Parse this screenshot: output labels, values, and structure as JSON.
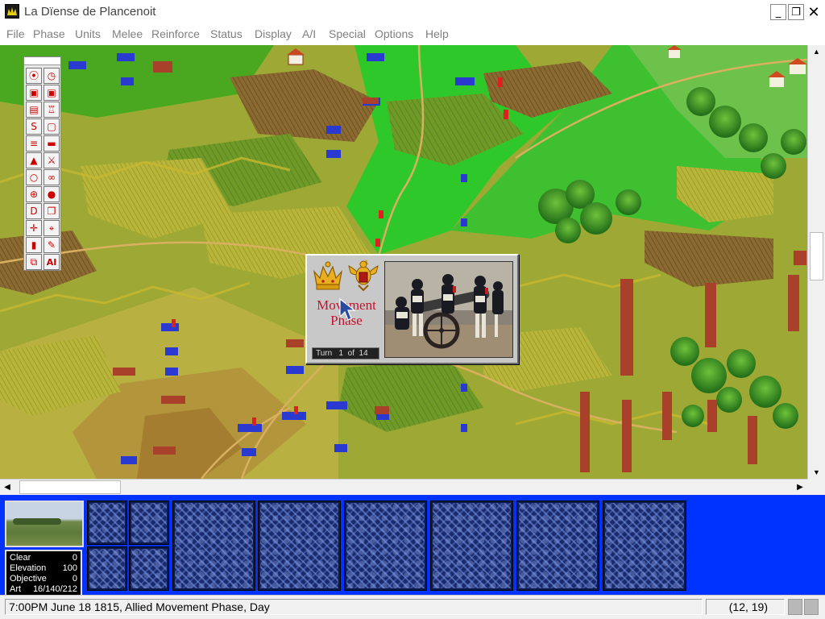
{
  "window": {
    "title": "La Dïense de Plancenoit",
    "minimize_glyph": "_",
    "maximize_glyph": "❐",
    "close_glyph": "✕"
  },
  "menu": [
    {
      "label": "File"
    },
    {
      "label": "Phase"
    },
    {
      "label": "Units"
    },
    {
      "label": "Melee"
    },
    {
      "label": "Reinforce"
    },
    {
      "label": "Status"
    },
    {
      "label": "Display"
    },
    {
      "label": "A/I"
    },
    {
      "label": "Special"
    },
    {
      "label": "Options"
    },
    {
      "label": "Help"
    }
  ],
  "toolbar": {
    "buttons": [
      {
        "icon": "compass-icon",
        "glyph": "⦿"
      },
      {
        "icon": "clock-icon",
        "glyph": "◷"
      },
      {
        "icon": "trash-can-icon",
        "glyph": "▣"
      },
      {
        "icon": "trash-all-icon",
        "glyph": "▣"
      },
      {
        "icon": "stack-icon",
        "glyph": "▤"
      },
      {
        "icon": "troops-icon",
        "glyph": "♖"
      },
      {
        "icon": "scroll-s-icon",
        "glyph": "S"
      },
      {
        "icon": "frame-icon",
        "glyph": "▢"
      },
      {
        "icon": "report-icon",
        "glyph": "≡"
      },
      {
        "icon": "oval-icon",
        "glyph": "▬"
      },
      {
        "icon": "pyramid-icon",
        "glyph": "▲"
      },
      {
        "icon": "crossed-swords-icon",
        "glyph": "⚔"
      },
      {
        "icon": "circle-icon",
        "glyph": "○"
      },
      {
        "icon": "binoculars-icon",
        "glyph": "∞"
      },
      {
        "icon": "target-icon",
        "glyph": "⊕"
      },
      {
        "icon": "ball-icon",
        "glyph": "●"
      },
      {
        "icon": "d-icon",
        "glyph": "D"
      },
      {
        "icon": "windows-icon",
        "glyph": "❐"
      },
      {
        "icon": "move-arrows-icon",
        "glyph": "✛"
      },
      {
        "icon": "crosshair-icon",
        "glyph": "⌖"
      },
      {
        "icon": "door-icon",
        "glyph": "▮"
      },
      {
        "icon": "pen-icon",
        "glyph": "✎"
      },
      {
        "icon": "overlap-icon",
        "glyph": "⧉"
      },
      {
        "icon": "ai-icon",
        "glyph": "AI"
      }
    ]
  },
  "dialog": {
    "title": "Movement Phase",
    "turn": "Turn   1  of  14"
  },
  "terrain": {
    "rows": [
      {
        "label": "Clear",
        "value": "0"
      },
      {
        "label": "Elevation",
        "value": "100"
      },
      {
        "label": "Objective",
        "value": "0"
      },
      {
        "label": "Art",
        "value": "16/140/212"
      }
    ]
  },
  "status": {
    "message": "7:00PM June 18 1815, Allied Movement Phase, Day",
    "coordinates": "(12, 19)"
  },
  "scroll": {
    "up": "▲",
    "down": "▼",
    "left": "◀",
    "right": "▶"
  },
  "colors": {
    "panel_blue": "#0033ff",
    "dialog_title_red": "#c8102e"
  }
}
